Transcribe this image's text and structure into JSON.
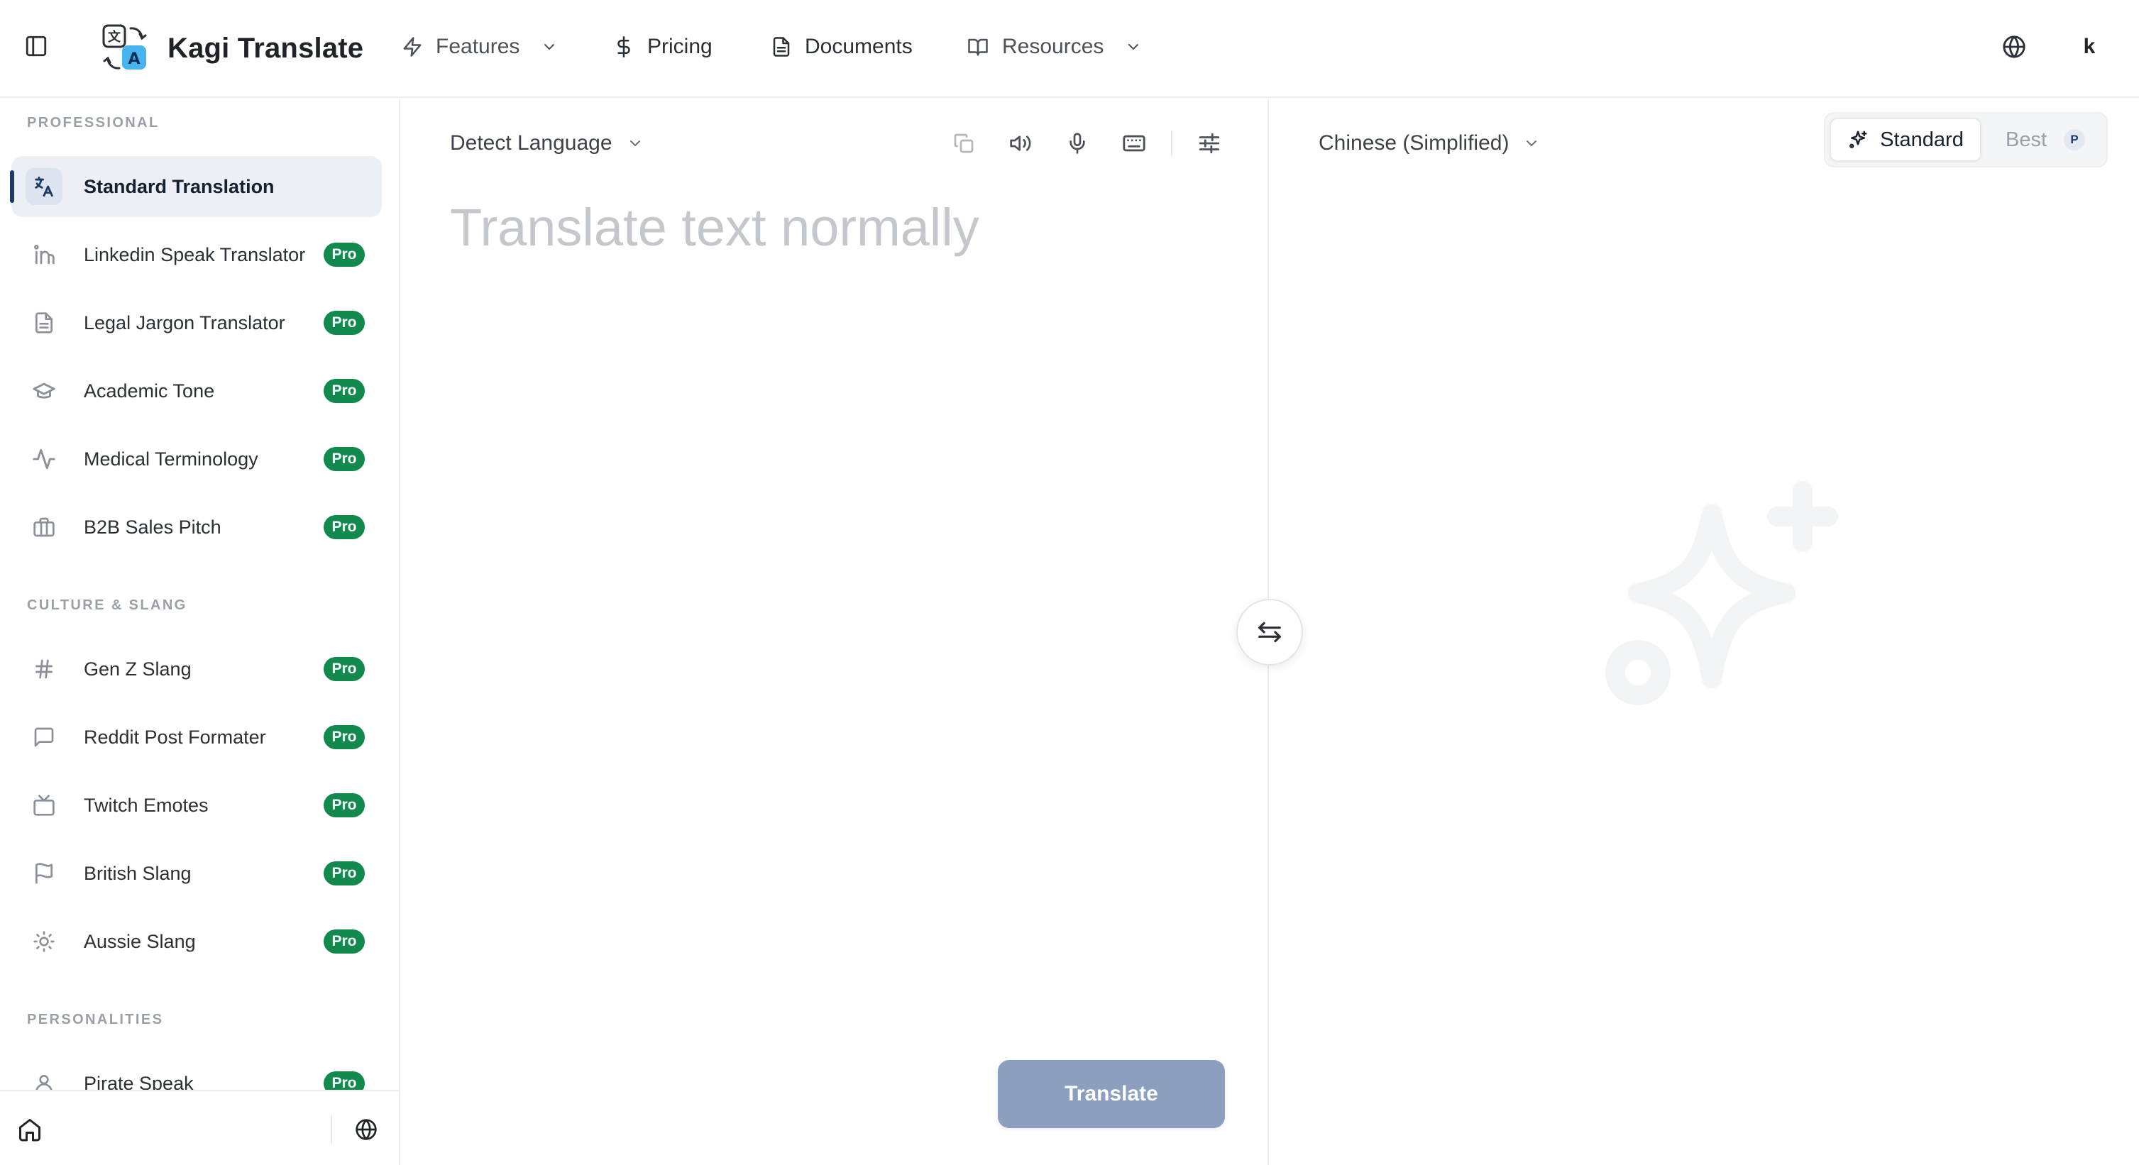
{
  "app": {
    "title": "Kagi Translate"
  },
  "header": {
    "nav": [
      {
        "label": "Features",
        "icon": "bolt-icon",
        "has_dropdown": true
      },
      {
        "label": "Pricing",
        "icon": "dollar-icon",
        "has_dropdown": false
      },
      {
        "label": "Documents",
        "icon": "document-icon",
        "has_dropdown": false
      },
      {
        "label": "Resources",
        "icon": "book-icon",
        "has_dropdown": true
      }
    ],
    "user_initial": "k"
  },
  "sidebar": {
    "sections": [
      {
        "title": "PROFESSIONAL",
        "items": [
          {
            "label": "Standard Translation",
            "icon": "translate-icon",
            "active": true,
            "badge": ""
          },
          {
            "label": "Linkedin Speak Translator",
            "icon": "linkedin-icon",
            "badge": "Pro"
          },
          {
            "label": "Legal Jargon Translator",
            "icon": "document-icon",
            "badge": "Pro"
          },
          {
            "label": "Academic Tone",
            "icon": "graduation-cap-icon",
            "badge": "Pro"
          },
          {
            "label": "Medical Terminology",
            "icon": "pulse-icon",
            "badge": "Pro"
          },
          {
            "label": "B2B Sales Pitch",
            "icon": "briefcase-icon",
            "badge": "Pro"
          }
        ]
      },
      {
        "title": "CULTURE & SLANG",
        "items": [
          {
            "label": "Gen Z Slang",
            "icon": "hash-icon",
            "badge": "Pro"
          },
          {
            "label": "Reddit Post Formater",
            "icon": "message-square-icon",
            "badge": "Pro"
          },
          {
            "label": "Twitch Emotes",
            "icon": "tv-icon",
            "badge": "Pro"
          },
          {
            "label": "British Slang",
            "icon": "flag-icon",
            "badge": "Pro"
          },
          {
            "label": "Aussie Slang",
            "icon": "sun-icon",
            "badge": "Pro"
          }
        ]
      },
      {
        "title": "PERSONALITIES",
        "items": [
          {
            "label": "Pirate Speak",
            "icon": "user-icon",
            "badge": "Pro"
          }
        ]
      }
    ]
  },
  "source": {
    "language": "Detect Language",
    "placeholder": "Translate text normally",
    "translate_label": "Translate"
  },
  "target": {
    "language": "Chinese (Simplified)",
    "quality": {
      "standard_label": "Standard",
      "best_label": "Best",
      "best_badge": "P",
      "selected": "Standard"
    }
  },
  "colors": {
    "pro_badge": "#128a4e",
    "active_item_bg": "#eceff6",
    "active_indicator": "#1d3b66",
    "translate_button": "#8c9fbf"
  }
}
